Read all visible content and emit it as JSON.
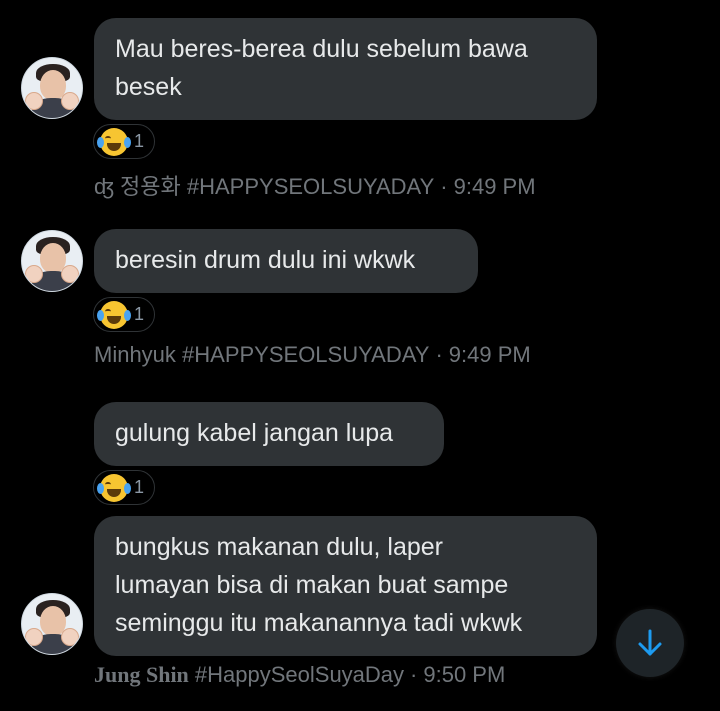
{
  "messages": [
    {
      "text": "Mau beres-berea dulu sebelum bawa\nbesek",
      "reaction": {
        "emoji": "face-with-tears-of-joy",
        "count": "1"
      },
      "meta": {
        "name": "ʤ 정용화 #HAPPYSEOLSUYADAY",
        "sep": "·",
        "time": "9:49 PM"
      }
    },
    {
      "text": "beresin drum dulu ini wkwk",
      "reaction": {
        "emoji": "face-with-tears-of-joy",
        "count": "1"
      },
      "meta": {
        "name": "Minhyuk #HAPPYSEOLSUYADAY",
        "sep": "·",
        "time": "9:49 PM"
      }
    },
    {
      "text": "gulung kabel jangan lupa",
      "reaction": {
        "emoji": "face-with-tears-of-joy",
        "count": "1"
      }
    },
    {
      "text": "bungkus makanan dulu, laper\nlumayan bisa di makan buat sampe\nseminggu itu makanannya tadi wkwk",
      "meta": {
        "name_styled": "Jung Shin",
        "name_rest": " #HappySeolSuyaDay",
        "sep": "·",
        "time": "9:50 PM"
      }
    }
  ],
  "scroll_button": {
    "icon": "arrow-down-icon",
    "color": "#1d9bf0"
  },
  "colors": {
    "bubble": "#2f3336",
    "background": "#000000",
    "meta": "#71767b"
  }
}
